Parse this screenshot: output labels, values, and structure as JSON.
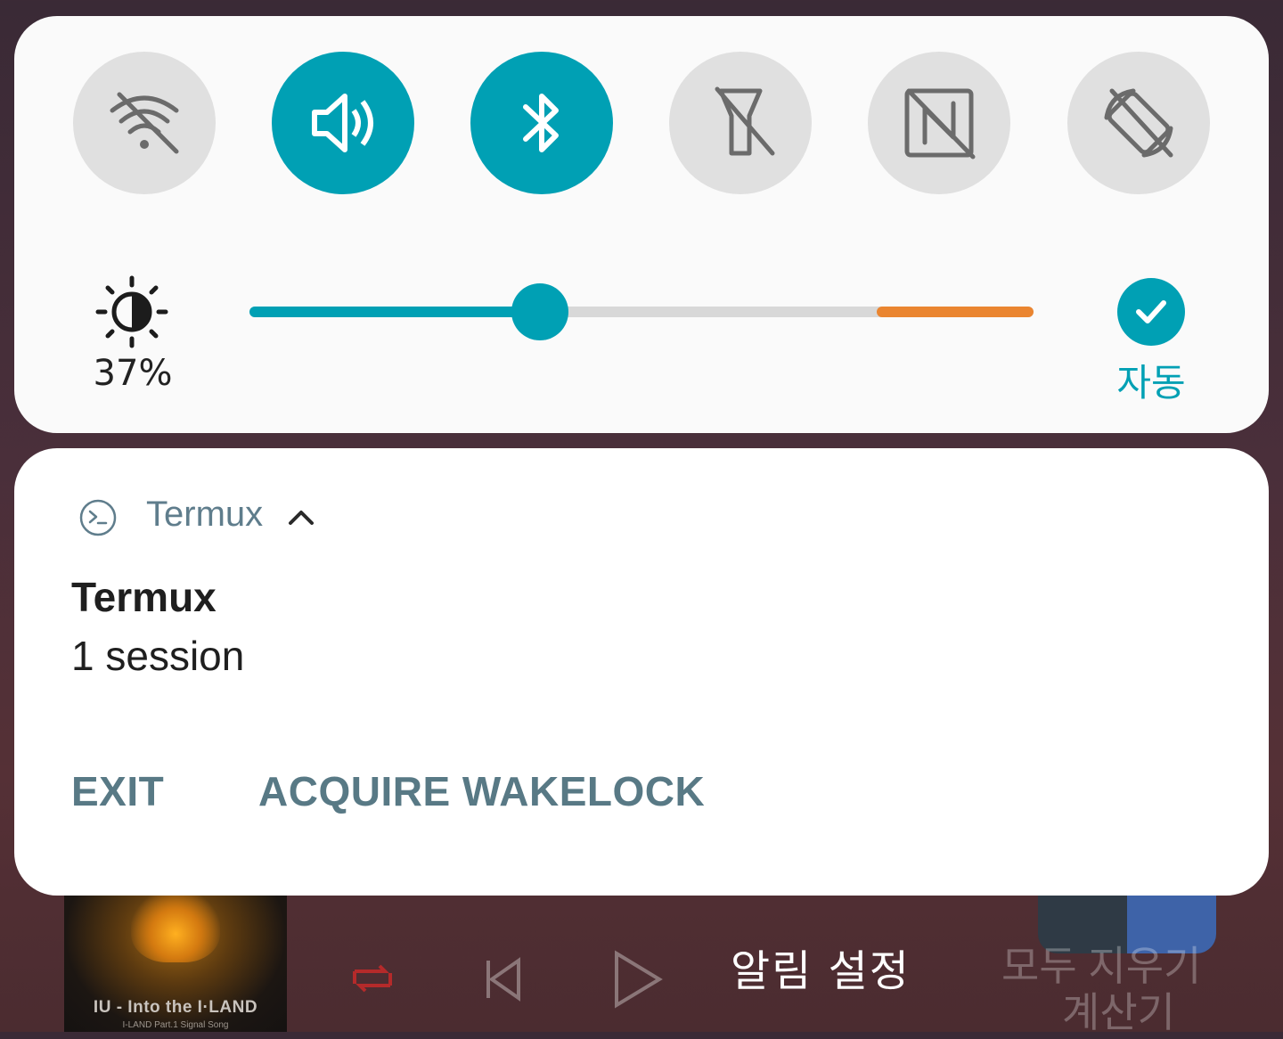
{
  "quick_settings": {
    "toggles": [
      {
        "name": "wifi",
        "icon": "wifi-off-icon",
        "state": "off"
      },
      {
        "name": "sound",
        "icon": "volume-icon",
        "state": "on"
      },
      {
        "name": "bluetooth",
        "icon": "bluetooth-icon",
        "state": "on"
      },
      {
        "name": "flashlight",
        "icon": "flashlight-off-icon",
        "state": "off"
      },
      {
        "name": "nfc",
        "icon": "nfc-off-icon",
        "state": "off"
      },
      {
        "name": "auto-rotate",
        "icon": "rotate-off-icon",
        "state": "off"
      }
    ],
    "brightness": {
      "percent_label": "37%",
      "value": 0.37,
      "auto_label": "자동",
      "auto_enabled": true
    },
    "colors": {
      "accent": "#00a0b4",
      "off": "#e0e0e0",
      "warning": "#ea8530"
    }
  },
  "notification": {
    "app_name": "Termux",
    "title": "Termux",
    "text": "1 session",
    "actions": [
      "EXIT",
      "ACQUIRE WAKELOCK"
    ]
  },
  "background": {
    "album_title": "IU - Into the I·LAND",
    "album_subtitle": "I-LAND Part.1 Signal Song",
    "notification_settings_label": "알림 설정",
    "clear_all_label": "모두 지우기",
    "app_label": "계산기"
  }
}
